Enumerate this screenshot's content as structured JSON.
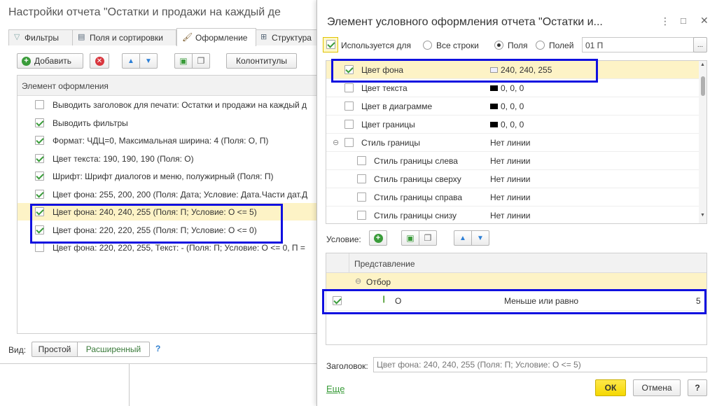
{
  "left_window": {
    "title": "Настройки отчета \"Остатки и продажи на каждый де",
    "tabs": [
      "Фильтры",
      "Поля и сортировки",
      "Оформление",
      "Структура"
    ],
    "toolbar": {
      "add_label": "Добавить",
      "headers_label": "Колонтитулы"
    },
    "list_header": "Элемент оформления",
    "items": [
      {
        "checked": false,
        "text": "Выводить заголовок для печати: Остатки и продажи на каждый д"
      },
      {
        "checked": true,
        "text": "Выводить фильтры"
      },
      {
        "checked": true,
        "text": "Формат: ЧДЦ=0, Максимальная ширина: 4 (Поля: О, П)"
      },
      {
        "checked": true,
        "text": "Цвет текста: 190, 190, 190 (Поля: О)"
      },
      {
        "checked": true,
        "text": "Шрифт: Шрифт диалогов и меню, полужирный (Поля: П)"
      },
      {
        "checked": true,
        "text": "Цвет фона: 255, 200, 200 (Поля: Дата; Условие: Дата.Части дат.Д"
      },
      {
        "checked": true,
        "text": "Цвет фона: 240, 240, 255 (Поля: П; Условие: О <= 5)"
      },
      {
        "checked": true,
        "text": "Цвет фона: 220, 220, 255 (Поля: П; Условие: О <= 0)"
      },
      {
        "checked": false,
        "text": "Цвет фона: 220, 220, 255, Текст: - (Поля: П; Условие: О <= 0, П ="
      }
    ],
    "view_label": "Вид:",
    "view_simple": "Простой",
    "view_advanced": "Расширенный",
    "help": "?"
  },
  "dialog": {
    "title": "Элемент условного оформления отчета \"Остатки и...",
    "used_for_label": "Используется для",
    "radio_all_rows": "Все строки",
    "radio_fields": "Поля",
    "radio_fields_n": "Полей",
    "fields_value": "01 П",
    "ellipsis": "...",
    "props": [
      {
        "name": "Цвет фона",
        "value": "240, 240, 255",
        "checked": true,
        "swatch": "#f0f0ff",
        "indent": 0
      },
      {
        "name": "Цвет текста",
        "value": "0, 0, 0",
        "checked": false,
        "swatch": "#000000",
        "indent": 0
      },
      {
        "name": "Цвет в диаграмме",
        "value": "0, 0, 0",
        "checked": false,
        "swatch": "#000000",
        "indent": 0
      },
      {
        "name": "Цвет границы",
        "value": "0, 0, 0",
        "checked": false,
        "swatch": "#000000",
        "indent": 0
      },
      {
        "name": "Стиль границы",
        "value": "Нет линии",
        "checked": false,
        "swatch": "",
        "indent": 0
      },
      {
        "name": "Стиль границы слева",
        "value": "Нет линии",
        "checked": false,
        "swatch": "",
        "indent": 1
      },
      {
        "name": "Стиль границы сверху",
        "value": "Нет линии",
        "checked": false,
        "swatch": "",
        "indent": 1
      },
      {
        "name": "Стиль границы справа",
        "value": "Нет линии",
        "checked": false,
        "swatch": "",
        "indent": 1
      },
      {
        "name": "Стиль границы снизу",
        "value": "Нет линии",
        "checked": false,
        "swatch": "",
        "indent": 1
      }
    ],
    "condition_label": "Условие:",
    "cond_header": "Представление",
    "cond_group": "Отбор",
    "cond_row": {
      "field": "О",
      "op": "Меньше или равно",
      "value": "5"
    },
    "caption_label": "Заголовок:",
    "caption_placeholder": "Цвет фона: 240, 240, 255 (Поля: П; Условие: О <= 5)",
    "more_link": "Еще",
    "ok_label": "ОК",
    "cancel_label": "Отмена",
    "help": "?"
  },
  "colors": {
    "highlight": "#1010e0",
    "selected_row": "#fdf3c6",
    "accent_yellow": "#f5d800",
    "green": "#3a9c3a"
  }
}
